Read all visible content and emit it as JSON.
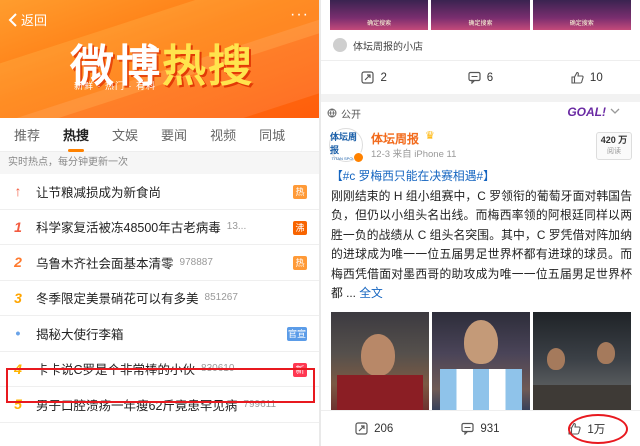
{
  "left": {
    "back_label": "返回",
    "more_label": "···",
    "banner": {
      "title_a": "微博",
      "title_b": "热搜",
      "subtitle": "新鲜 · 热门 · 有料"
    },
    "tabs": [
      "推荐",
      "热搜",
      "文娱",
      "要闻",
      "视频",
      "同城"
    ],
    "active_tab": "热搜",
    "realtime_label": "实时热点，每分钟更新一次",
    "hot_items": [
      {
        "rank": "↑",
        "title": "让节粮减损成为新食尚",
        "count": "",
        "badge": "热",
        "badge_color": "#ff9a37"
      },
      {
        "rank": "1",
        "title": "科学家复活被冻48500年古老病毒",
        "count": "13...",
        "badge": "沸",
        "badge_color": "#f86400"
      },
      {
        "rank": "2",
        "title": "乌鲁木齐社会面基本清零",
        "count": "978887",
        "badge": "热",
        "badge_color": "#ff9a37"
      },
      {
        "rank": "3",
        "title": "冬季限定美景硝花可以有多美",
        "count": "851267",
        "badge": "",
        "badge_color": ""
      },
      {
        "rank": "•",
        "title": "揭秘大使行李箱",
        "count": "",
        "badge": "官宣",
        "badge_color": "#5b9ce8"
      },
      {
        "rank": "4",
        "title": "卡卡说C罗是个非常棒的小伙",
        "count": "830610",
        "badge": "新",
        "badge_color": "#ff3852"
      },
      {
        "rank": "5",
        "title": "男子口腔溃疡一年瘦62斤竟患罕见病",
        "count": "799611",
        "badge": "",
        "badge_color": ""
      }
    ]
  },
  "right": {
    "image_captions": [
      "确定搜索",
      "确定搜索",
      "确定搜索"
    ],
    "source_label": "体坛周报的小店",
    "top_actions": {
      "repost": "2",
      "comment": "6",
      "like": "10"
    },
    "public_label": "公开",
    "goal_logo": "GOAL!",
    "author": {
      "name": "体坛周报",
      "avatar_text": "体坛周报",
      "avatar_sub": "TITAN SPORTS",
      "meta": "12-3 来自 iPhone 11"
    },
    "reads": {
      "count": "420 万",
      "label": "阅读"
    },
    "post": {
      "tag": "【#c 罗梅西只能在决赛相遇#】",
      "body": "刚刚结束的 H 组小组赛中，C 罗领衔的葡萄牙面对韩国告负，但仍以小组头名出线。而梅西率领的阿根廷同样以两胜一负的战绩从 C 组头名突围。其中，C 罗凭借对阵加纳的进球成为唯一一位五届男足世界杯都有进球的球员。而梅西凭借面对墨西哥的助攻成为唯一一位五届男足世界杯都 ...",
      "full_text": "全文"
    },
    "bottom_actions": {
      "repost": "206",
      "comment": "931",
      "like": "1万"
    }
  }
}
